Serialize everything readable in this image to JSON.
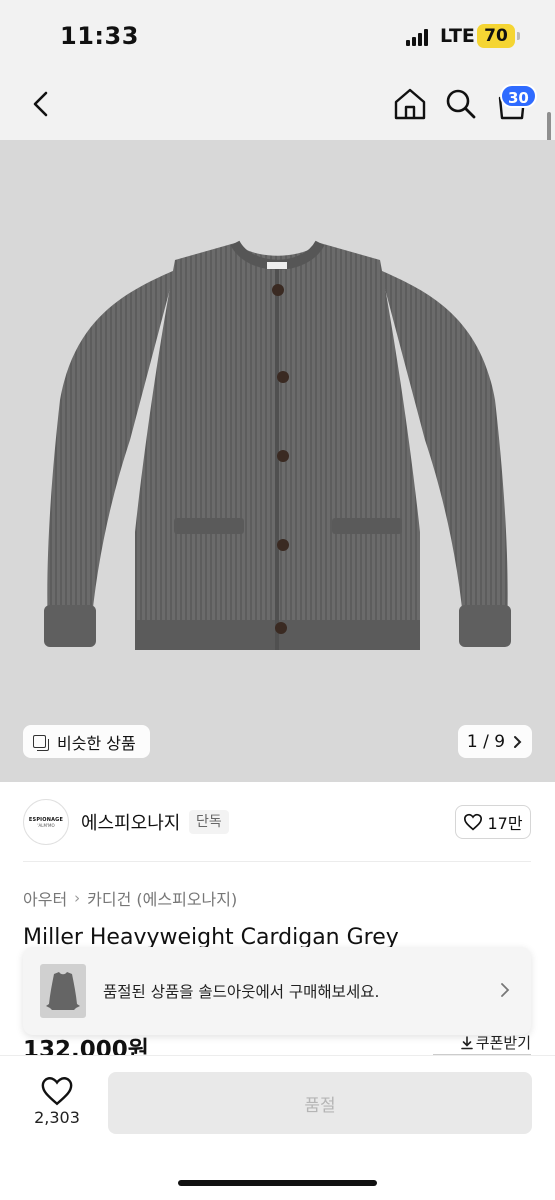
{
  "status_bar": {
    "time": "11:33",
    "network": "LTE",
    "battery": "70"
  },
  "nav": {
    "cart_badge": "30"
  },
  "gallery": {
    "similar_label": "비슷한 상품",
    "counter": "1 / 9"
  },
  "brand": {
    "logo_line1": "ESPIONAGE",
    "logo_line2": "'ALM'MO",
    "name": "에스피오나지",
    "tag": "단독",
    "likes": "17만"
  },
  "breadcrumb": {
    "category": "아우터",
    "subcategory": "카디건 (에스피오나지)"
  },
  "product": {
    "title": "Miller Heavyweight Cardigan Grey",
    "price": "132,000원",
    "coupon_label": "쿠폰받기"
  },
  "banner": {
    "text": "품절된 상품을 솔드아웃에서 구매해보세요."
  },
  "bottom": {
    "like_count": "2,303",
    "soldout_label": "품절"
  },
  "colors": {
    "accent": "#2f6bff",
    "battery": "#f5d533",
    "product_bg": "#d8d8d8",
    "cardigan": "#6b6b6b"
  },
  "icons": [
    "back-arrow-icon",
    "home-icon",
    "search-icon",
    "cart-icon",
    "similar-items-icon",
    "chevron-right-icon",
    "heart-icon",
    "download-icon"
  ]
}
